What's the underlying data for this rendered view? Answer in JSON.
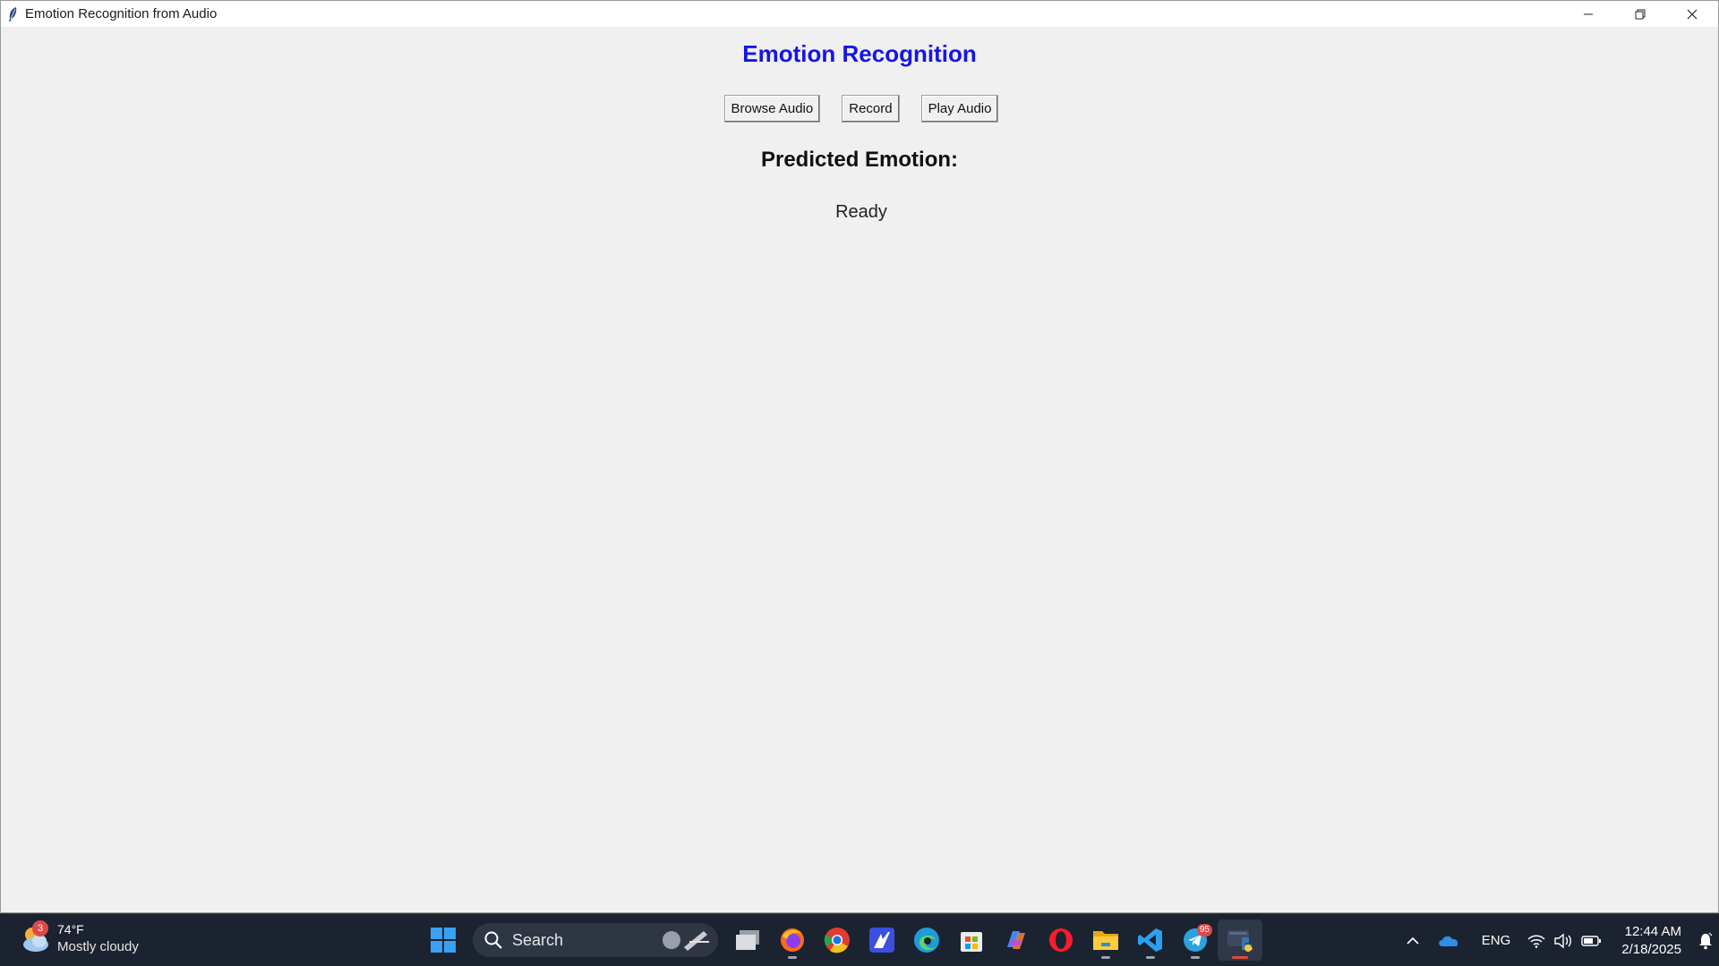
{
  "window": {
    "title": "Emotion Recognition from Audio"
  },
  "app": {
    "heading": "Emotion Recognition",
    "heading_color": "#1515e6",
    "buttons": {
      "browse": "Browse Audio",
      "record": "Record",
      "play": "Play Audio"
    },
    "prediction_label": "Predicted Emotion:",
    "status": "Ready"
  },
  "taskbar": {
    "weather": {
      "badge": "3",
      "temperature": "74°F",
      "condition": "Mostly cloudy"
    },
    "search": {
      "placeholder": "Search"
    },
    "apps": [
      {
        "name": "task-view-icon"
      },
      {
        "name": "firefox-icon"
      },
      {
        "name": "chrome-icon"
      },
      {
        "name": "app-icon"
      },
      {
        "name": "edge-icon"
      },
      {
        "name": "microsoft-store-icon"
      },
      {
        "name": "copilot-icon"
      },
      {
        "name": "opera-icon"
      },
      {
        "name": "file-explorer-icon"
      },
      {
        "name": "vscode-icon"
      },
      {
        "name": "telegram-icon"
      },
      {
        "name": "python-icon"
      }
    ],
    "telegram_badge": "95",
    "tray": {
      "language": "ENG",
      "time": "12:44 AM",
      "date": "2/18/2025"
    }
  }
}
